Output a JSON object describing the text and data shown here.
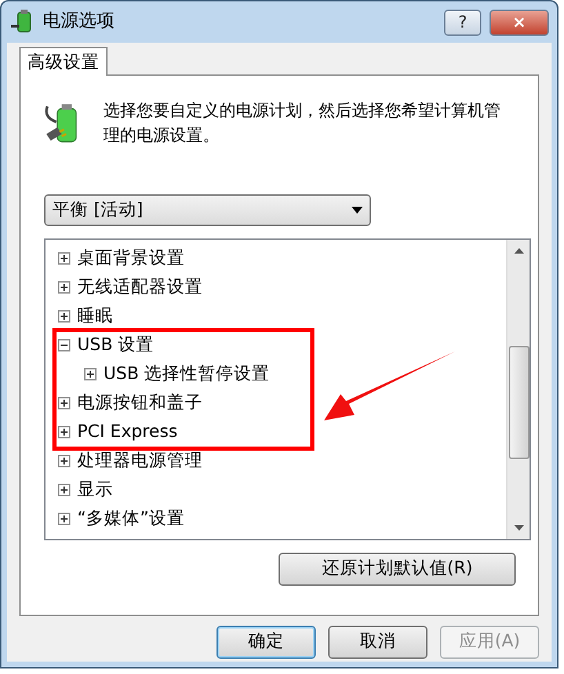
{
  "window": {
    "title": "电源选项",
    "buttons": [
      "?",
      "×"
    ]
  },
  "tabs": [
    {
      "label": "高级设置",
      "selected": true
    }
  ],
  "description": "选择您要自定义的电源计划，然后选择您希望计算机管理的电源设置。",
  "plan_select": {
    "value": "平衡 [活动]"
  },
  "settings_tree": [
    {
      "label": "桌面背景设置",
      "expanded": false
    },
    {
      "label": "无线适配器设置",
      "expanded": false
    },
    {
      "label": "睡眠",
      "expanded": false
    },
    {
      "label": "USB 设置",
      "expanded": true,
      "children": [
        {
          "label": "USB 选择性暂停设置",
          "expanded": false
        }
      ]
    },
    {
      "label": "电源按钮和盖子",
      "expanded": false
    },
    {
      "label": "PCI Express",
      "expanded": false
    },
    {
      "label": "处理器电源管理",
      "expanded": false
    },
    {
      "label": "显示",
      "expanded": false
    },
    {
      "label": "“多媒体”设置",
      "expanded": false
    }
  ],
  "restore_button": {
    "label": "还原计划默认值(R)"
  },
  "dialog_buttons": [
    {
      "label": "确定",
      "default": true,
      "disabled": false
    },
    {
      "label": "取消",
      "default": false,
      "disabled": false
    },
    {
      "label": "应用(A)",
      "default": false,
      "disabled": true
    }
  ]
}
